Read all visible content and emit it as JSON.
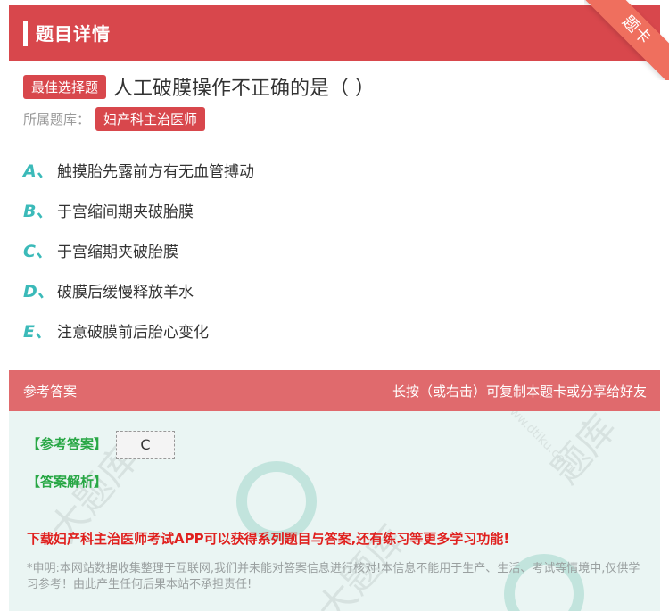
{
  "header": {
    "title": "题目详情",
    "ribbon": "题卡"
  },
  "question": {
    "type_badge": "最佳选择题",
    "text": "人工破膜操作不正确的是（ ）",
    "bank_label": "所属题库：",
    "bank_name": "妇产科主治医师"
  },
  "options": [
    {
      "letter": "A、",
      "text": "触摸胎先露前方有无血管搏动"
    },
    {
      "letter": "B、",
      "text": "于宫缩间期夹破胎膜"
    },
    {
      "letter": "C、",
      "text": "于宫缩期夹破胎膜"
    },
    {
      "letter": "D、",
      "text": "破膜后缓慢释放羊水"
    },
    {
      "letter": "E、",
      "text": "注意破膜前后胎心变化"
    }
  ],
  "answer_section": {
    "title": "参考答案",
    "hint": "长按（或右击）可复制本题卡或分享给好友",
    "answer_label": "【参考答案】",
    "answer_value": "C",
    "analysis_label": "【答案解析】",
    "promo": "下载妇产科主治医师考试APP可以获得系列题目与答案,还有练习等更多学习功能!",
    "notice": "*申明:本网站数据收集整理于互联网,我们并未能对答案信息进行核对!本信息不能用于生产、生活、考试等情境中,仅供学习参考！由此产生任何后果本站不承担责任!"
  },
  "colors": {
    "accent": "#d8474c",
    "option_letter": "#3bbab9",
    "answer_green": "#28a745",
    "promo_red": "#e0201e"
  }
}
